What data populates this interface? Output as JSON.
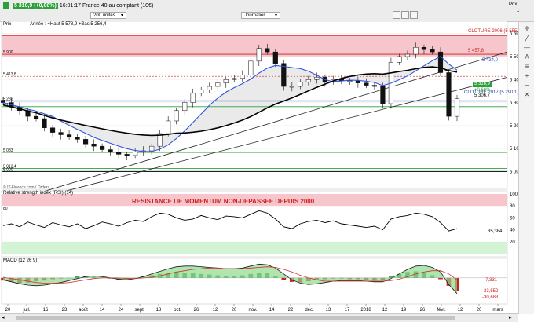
{
  "toolbar": {
    "quote_prefix": "5 316,9 (+0,66%)",
    "quote_suffix": "16:01:17 France 40 au comptant (10€)",
    "units_select": "200 unités",
    "period_select": "Journalier",
    "cursor_label": "Prix",
    "cursor_value": "1",
    "pane_ohlc": "Année : +Haut 5 578,9 +Bas 5 256,4"
  },
  "pane_labels": {
    "price": "Prix",
    "rsi": "Relative strength index (RSI) (14)",
    "macd": "MACD (12 26 9)",
    "copyright": "© IT-Finance.com / Orders"
  },
  "annotations": {
    "cloture_2006": "CLOTURE 2006 (5 555)",
    "cloture_2017": "CLOTURE 2017 (5 290,1)",
    "rsi_resistance": "RESISTANCE DE MOMENTUM NON-DEPASSEE DEPUIS 2000"
  },
  "price_badges": {
    "current": "5 316,9",
    "change": "+0,66%",
    "line_457": "5 457,8",
    "line_434": "5 434,0",
    "line_306": "5 306,7"
  },
  "colors": {
    "bull": "#2c9f3a",
    "bear": "#cc2020",
    "red_zone": "#f6c6cc",
    "green_zone": "#d4f2d4",
    "ma_blue": "#3355dd",
    "ma_black": "#000000"
  },
  "chart_data": {
    "type": "line",
    "price_axis": {
      "ylim": [
        4950,
        5640
      ],
      "ticks": [
        5000,
        5100,
        5200,
        5300,
        5400,
        5500,
        5600
      ],
      "tick_labels": [
        "5 000",
        "5 100",
        "5 200",
        "5 300",
        "5 400",
        "5 500",
        "5 600"
      ],
      "levels": [
        {
          "label": "5 900",
          "value": 5510
        },
        {
          "label": "5 413,8",
          "value": 5413.8
        },
        {
          "label": "5 286",
          "value": 5307
        },
        {
          "label": "5 255",
          "value": 5282
        },
        {
          "label": "5 083",
          "value": 5083
        },
        {
          "label": "5 013,4",
          "value": 5013.4
        },
        {
          "label": "5 000",
          "value": 5000
        }
      ],
      "resistance_zone": [
        5500,
        5590
      ]
    },
    "x_labels": [
      "20",
      "juil.",
      "16",
      "23",
      "août",
      "14",
      "24",
      "sept.",
      "18",
      "oct.",
      "26",
      "12",
      "20",
      "nov.",
      "14",
      "22",
      "déc.",
      "13",
      "17",
      "2018",
      "12",
      "19",
      "26",
      "févr.",
      "12",
      "20",
      "mars"
    ],
    "close_series": [
      5300,
      5280,
      5265,
      5240,
      5230,
      5190,
      5170,
      5160,
      5150,
      5140,
      5120,
      5110,
      5095,
      5085,
      5075,
      5070,
      5085,
      5090,
      5110,
      5165,
      5220,
      5265,
      5300,
      5340,
      5355,
      5370,
      5385,
      5400,
      5405,
      5420,
      5480,
      5535,
      5520,
      5470,
      5370,
      5370,
      5390,
      5400,
      5410,
      5390,
      5400,
      5395,
      5395,
      5385,
      5375,
      5370,
      5295,
      5475,
      5500,
      5510,
      5540,
      5530,
      5520,
      5430,
      5240,
      5316.9
    ],
    "rsi": {
      "ylim": [
        0,
        100
      ],
      "ticks": [
        20,
        40,
        60,
        80,
        100
      ],
      "zones": {
        "overbought": 80,
        "oversold": 20
      },
      "last": "35,384",
      "series": [
        47,
        50,
        45,
        53,
        48,
        44,
        52,
        48,
        45,
        50,
        42,
        47,
        53,
        50,
        46,
        52,
        56,
        54,
        62,
        68,
        66,
        60,
        56,
        58,
        64,
        60,
        57,
        63,
        62,
        60,
        66,
        72,
        68,
        58,
        45,
        42,
        50,
        54,
        56,
        52,
        55,
        50,
        48,
        46,
        44,
        46,
        40,
        58,
        62,
        64,
        68,
        66,
        62,
        52,
        38,
        42
      ]
    },
    "macd": {
      "ylim": [
        -35,
        25
      ],
      "labels": [
        "-7,331",
        "-23,552",
        "-30,683"
      ],
      "histogram": [
        -4,
        -6,
        -8,
        -7,
        -5,
        -4,
        -2,
        -1,
        0,
        2,
        3,
        2,
        1,
        -1,
        -3,
        -2,
        0,
        2,
        4,
        6,
        8,
        9,
        8,
        7,
        6,
        5,
        4,
        3,
        3,
        4,
        6,
        8,
        7,
        3,
        -3,
        -6,
        -7,
        -5,
        -3,
        -2,
        -1,
        -1,
        -2,
        -2,
        -3,
        -4,
        -3,
        2,
        6,
        9,
        10,
        8,
        4,
        -2,
        -12,
        -20
      ],
      "macd_line": [
        -3,
        -6,
        -9,
        -11,
        -12,
        -11,
        -9,
        -7,
        -4,
        -1,
        2,
        3,
        2,
        0,
        -2,
        -3,
        -1,
        2,
        6,
        10,
        14,
        17,
        18,
        18,
        17,
        16,
        15,
        14,
        14,
        15,
        18,
        21,
        20,
        15,
        6,
        -3,
        -8,
        -10,
        -9,
        -7,
        -5,
        -4,
        -4,
        -4,
        -5,
        -6,
        -6,
        -1,
        6,
        13,
        18,
        19,
        16,
        9,
        -10,
        -24
      ],
      "signal_line": [
        1,
        -1,
        -3,
        -5,
        -7,
        -8,
        -8,
        -8,
        -7,
        -5,
        -3,
        -1,
        0,
        0,
        0,
        -1,
        -1,
        0,
        1,
        3,
        6,
        9,
        11,
        13,
        14,
        15,
        15,
        14,
        14,
        14,
        15,
        16,
        17,
        16,
        13,
        9,
        4,
        0,
        -3,
        -5,
        -5,
        -5,
        -5,
        -5,
        -5,
        -5,
        -5,
        -4,
        -2,
        2,
        6,
        9,
        11,
        11,
        6,
        -3
      ]
    }
  }
}
